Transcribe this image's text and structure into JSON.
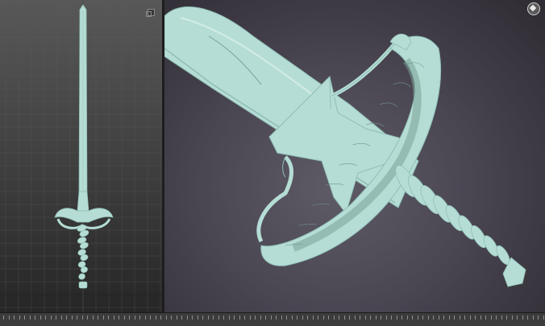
{
  "window": {
    "left_viewport_label": "",
    "right_viewport_label": ""
  },
  "colors": {
    "model": "#b5ddd5",
    "model_shadow": "#8fbdb5",
    "wire": "#7aa098",
    "viewport_bg": "#4a4652"
  },
  "icons": {
    "maximize": "maximize-viewport-icon",
    "viewcube": "viewcube-icon"
  }
}
